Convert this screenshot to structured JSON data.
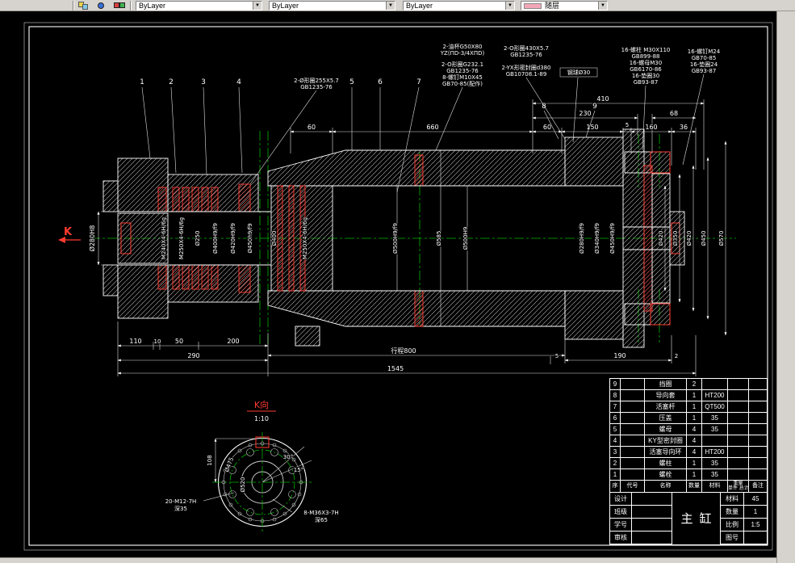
{
  "colors": {
    "chrome": "#d6d3ce",
    "canvas": "#000000",
    "line": "#ffffff",
    "red": "#ff3b30",
    "green": "#00b400"
  },
  "toolbar": {
    "combos": [
      {
        "label": "ByLayer"
      },
      {
        "label": "ByLayer"
      },
      {
        "label": "ByLayer"
      },
      {
        "label": "随层"
      }
    ]
  },
  "drawing": {
    "balloons": [
      "1",
      "2",
      "3",
      "4",
      "5",
      "6",
      "7",
      "8",
      "9"
    ],
    "section_marker": "K",
    "callouts": [
      {
        "lines": [
          "2-Ø形圈255X5.7",
          "GB1235-76"
        ]
      },
      {
        "lines": [
          "2-油杯G50X80",
          "YZ(ΠD-3/4XΠD)"
        ]
      },
      {
        "lines": [
          "2-O形圈G232.1",
          "GB1235-76"
        ]
      },
      {
        "lines": [
          "8-螺钉M10X45",
          "GB70-85(配作)"
        ]
      },
      {
        "lines": [
          "2-O形圈430X5.7",
          "GB1235-76"
        ]
      },
      {
        "lines": [
          "2-YX形密封圈d380",
          "GB10708.1-89"
        ]
      },
      {
        "lines": [
          "钢球Ø30"
        ]
      },
      {
        "lines": [
          "16-螺柱 M30X110",
          "GB899-88",
          "16-螺母M30",
          "GB6170-86",
          "16-垫圈30",
          "GB93-87"
        ]
      },
      {
        "lines": [
          "16-螺钉M24",
          "GB70-85",
          "16-垫圈24",
          "GB93-87"
        ]
      }
    ],
    "dims_top": [
      "60",
      "660",
      "60",
      "150",
      "5",
      "160",
      "36",
      "230",
      "68",
      "410"
    ],
    "dims_bottom": [
      "110",
      "10",
      "50",
      "200",
      "290",
      "行程800",
      "5",
      "190",
      "2",
      "1545"
    ],
    "dim_left": "Ø280H8",
    "dims_rotated": [
      "M240X4-6H/6g",
      "M250X4-6H/6g",
      "Ø250",
      "Ø400H9/f9",
      "Ø420H9/f9",
      "Ø450h9/f9",
      "Ø400",
      "M250X4-6H/6g",
      "Ø500H9/f9",
      "Ø585",
      "Ø500H9",
      "Ø280H9/f9",
      "Ø340H9/f9",
      "Ø450H9/f9",
      "Ø420",
      "Ø350",
      "Ø420",
      "Ø450",
      "Ø570"
    ],
    "detail": {
      "title": "K向",
      "scale": "1:10",
      "hole8": "8-M36X3-7H",
      "hole8_depth": "深65",
      "hole20": "20-M12-7H",
      "hole20_depth": "深35",
      "dia1": "Ø475",
      "dia2": "Ø520",
      "height": "108",
      "angle1": "30°",
      "angle2": "15°"
    }
  },
  "bom": {
    "header": {
      "seq": "序",
      "code": "代号",
      "name": "名称",
      "qty": "数量",
      "material": "材料",
      "weight": "重量",
      "weight_unit": "单件",
      "weight_total": "总计",
      "notes": "备注"
    },
    "items": [
      {
        "seq": "9",
        "code": "",
        "name": "挡圈",
        "qty": "2",
        "material": "",
        "notes": ""
      },
      {
        "seq": "8",
        "code": "",
        "name": "导向套",
        "qty": "1",
        "material": "HT200",
        "notes": ""
      },
      {
        "seq": "7",
        "code": "",
        "name": "活塞杆",
        "qty": "1",
        "material": "QT500",
        "notes": ""
      },
      {
        "seq": "6",
        "code": "",
        "name": "压盖",
        "qty": "1",
        "material": "35",
        "notes": ""
      },
      {
        "seq": "5",
        "code": "",
        "name": "螺母",
        "qty": "4",
        "material": "35",
        "notes": ""
      },
      {
        "seq": "4",
        "code": "",
        "name": "KY型密封圈",
        "qty": "4",
        "material": "",
        "notes": ""
      },
      {
        "seq": "3",
        "code": "",
        "name": "活塞导向环",
        "qty": "4",
        "material": "HT200",
        "notes": ""
      },
      {
        "seq": "2",
        "code": "",
        "name": "螺柱",
        "qty": "1",
        "material": "35",
        "notes": ""
      },
      {
        "seq": "1",
        "code": "",
        "name": "螺栓",
        "qty": "1",
        "material": "35",
        "notes": ""
      }
    ]
  },
  "titleblock": {
    "title": "主缸",
    "left_labels": [
      "设计",
      "班级",
      "学号",
      "审核"
    ],
    "right_rows": [
      {
        "label": "材料",
        "value": "45"
      },
      {
        "label": "数量",
        "value": "1"
      },
      {
        "label": "比例",
        "value": "1:5"
      },
      {
        "label": "图号",
        "value": ""
      }
    ]
  }
}
